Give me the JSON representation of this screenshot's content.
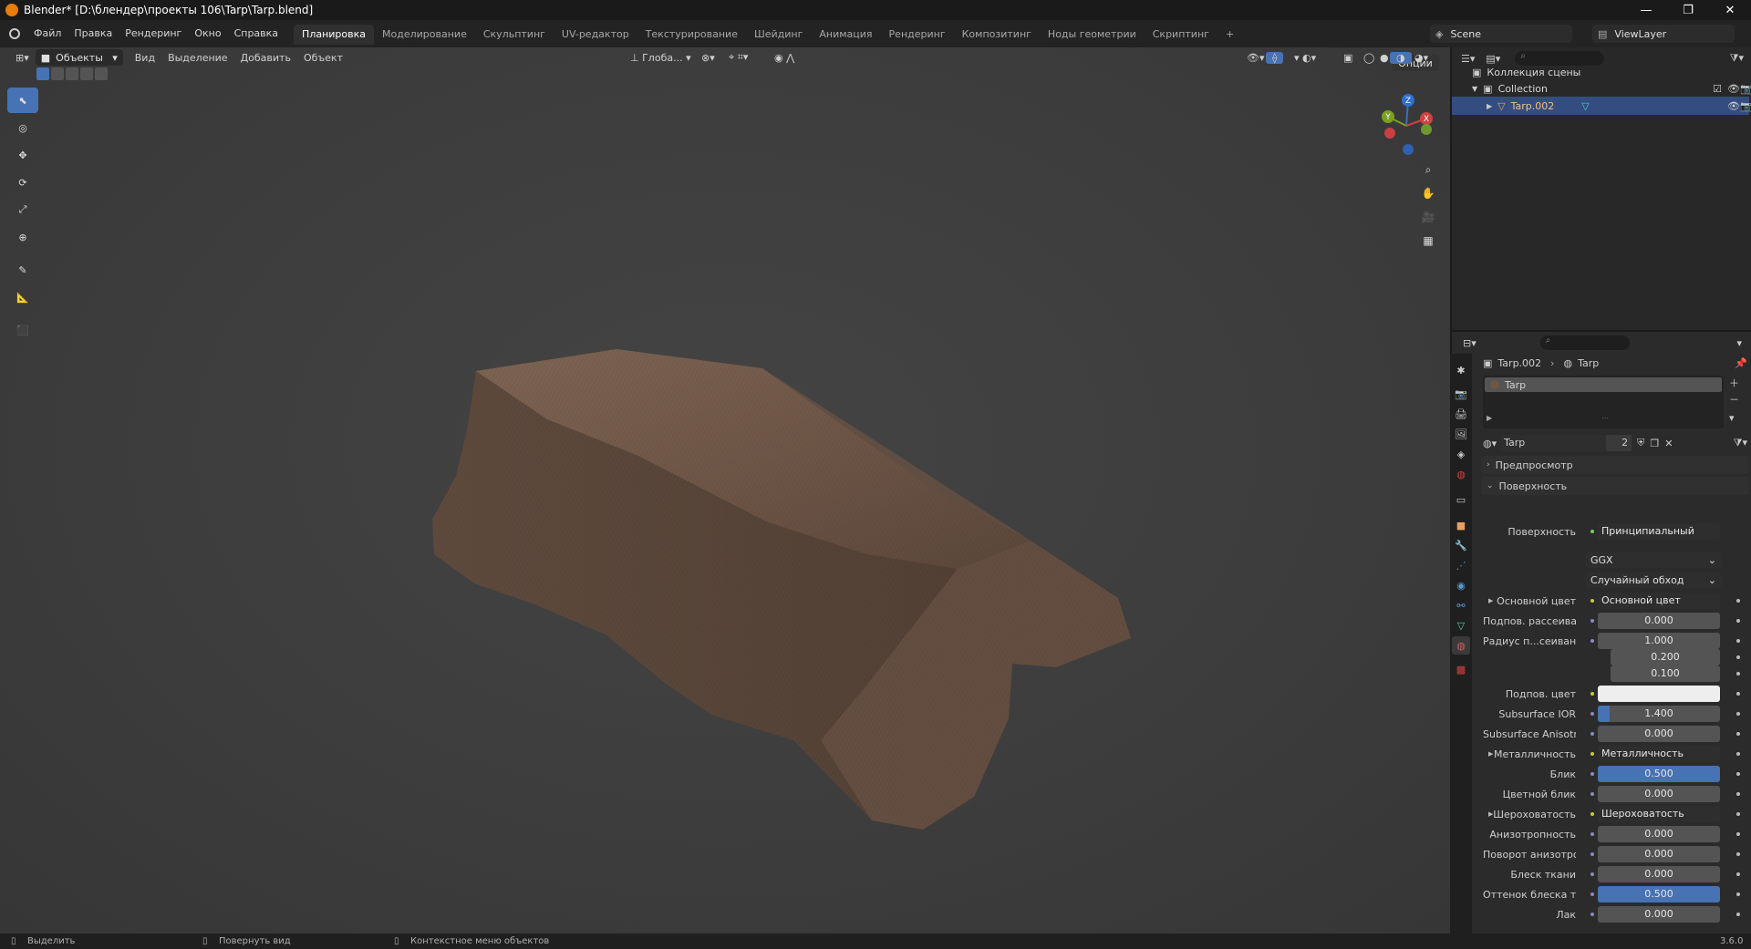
{
  "window": {
    "title": "Blender* [D:\\блендер\\проекты 106\\Tarp\\Tarp.blend]",
    "minimize": "—",
    "maximize": "❐",
    "close": "✕"
  },
  "menus": [
    "Файл",
    "Правка",
    "Рендеринг",
    "Окно",
    "Справка"
  ],
  "workspaces": [
    {
      "label": "Планировка",
      "active": true
    },
    {
      "label": "Моделирование"
    },
    {
      "label": "Скульптинг"
    },
    {
      "label": "UV-редактор"
    },
    {
      "label": "Текстурирование"
    },
    {
      "label": "Шейдинг"
    },
    {
      "label": "Анимация"
    },
    {
      "label": "Рендеринг"
    },
    {
      "label": "Композитинг"
    },
    {
      "label": "Ноды геометрии"
    },
    {
      "label": "Скриптинг"
    },
    {
      "label": "+"
    }
  ],
  "scene": {
    "name": "Scene",
    "view_layer": "ViewLayer"
  },
  "viewport": {
    "mode": "Объекты",
    "menus": [
      "Вид",
      "Выделение",
      "Добавить",
      "Объект"
    ],
    "orientation": "Глоба...",
    "options": "Опции",
    "gizmo": {
      "x": "X",
      "y": "Y",
      "z": "Z"
    }
  },
  "outliner": {
    "root": "Коллекция сцены",
    "collection": "Collection",
    "object": "Tarp.002"
  },
  "properties": {
    "breadcrumb_object": "Tarp.002",
    "breadcrumb_material": "Tarp",
    "slot_name": "Tarp",
    "material_name": "Tarp",
    "users": "2",
    "panel_preview": "Предпросмотр",
    "panel_surface": "Поверхность",
    "surface_label": "Поверхность",
    "surface_value": "Принципиальный BSDF",
    "distribution": "GGX",
    "subsurface_method": "Случайный обход",
    "rows": [
      {
        "label": "Основной цвет",
        "value": "Основной цвет",
        "kind": "link",
        "expand": true
      },
      {
        "label": "Подпов. рассеива...",
        "value": "0.000",
        "kind": "num"
      },
      {
        "label": "Радиус п...сеивания",
        "value": "1.000",
        "kind": "num"
      },
      {
        "label": "",
        "value": "0.200",
        "kind": "num"
      },
      {
        "label": "",
        "value": "0.100",
        "kind": "num"
      },
      {
        "label": "Подпов. цвет",
        "value": "",
        "kind": "color"
      },
      {
        "label": "Subsurface IOR",
        "value": "1.400",
        "kind": "num",
        "fill": 0.1
      },
      {
        "label": "Subsurface Anisotr...",
        "value": "0.000",
        "kind": "num"
      },
      {
        "label": "Металличность",
        "value": "Металличность",
        "kind": "link",
        "expand": true
      },
      {
        "label": "Блик",
        "value": "0.500",
        "kind": "num",
        "fill": 1
      },
      {
        "label": "Цветной блик",
        "value": "0.000",
        "kind": "num"
      },
      {
        "label": "Шероховатость",
        "value": "Шероховатость",
        "kind": "link",
        "expand": true
      },
      {
        "label": "Анизотропность",
        "value": "0.000",
        "kind": "num"
      },
      {
        "label": "Поворот анизотро...",
        "value": "0.000",
        "kind": "num"
      },
      {
        "label": "Блеск ткани",
        "value": "0.000",
        "kind": "num"
      },
      {
        "label": "Оттенок блеска тк...",
        "value": "0.500",
        "kind": "num",
        "fill": 1
      },
      {
        "label": "Лак",
        "value": "0.000",
        "kind": "num"
      }
    ]
  },
  "status": {
    "select": "Выделить",
    "rotate": "Повернуть вид",
    "context": "Контекстное меню объектов",
    "version": "3.6.0"
  },
  "colors": {
    "accent": "#4772b3",
    "highlight_row": "#334d80",
    "tarp": "#6e5647",
    "subsurface_color": "#eeeeee"
  }
}
